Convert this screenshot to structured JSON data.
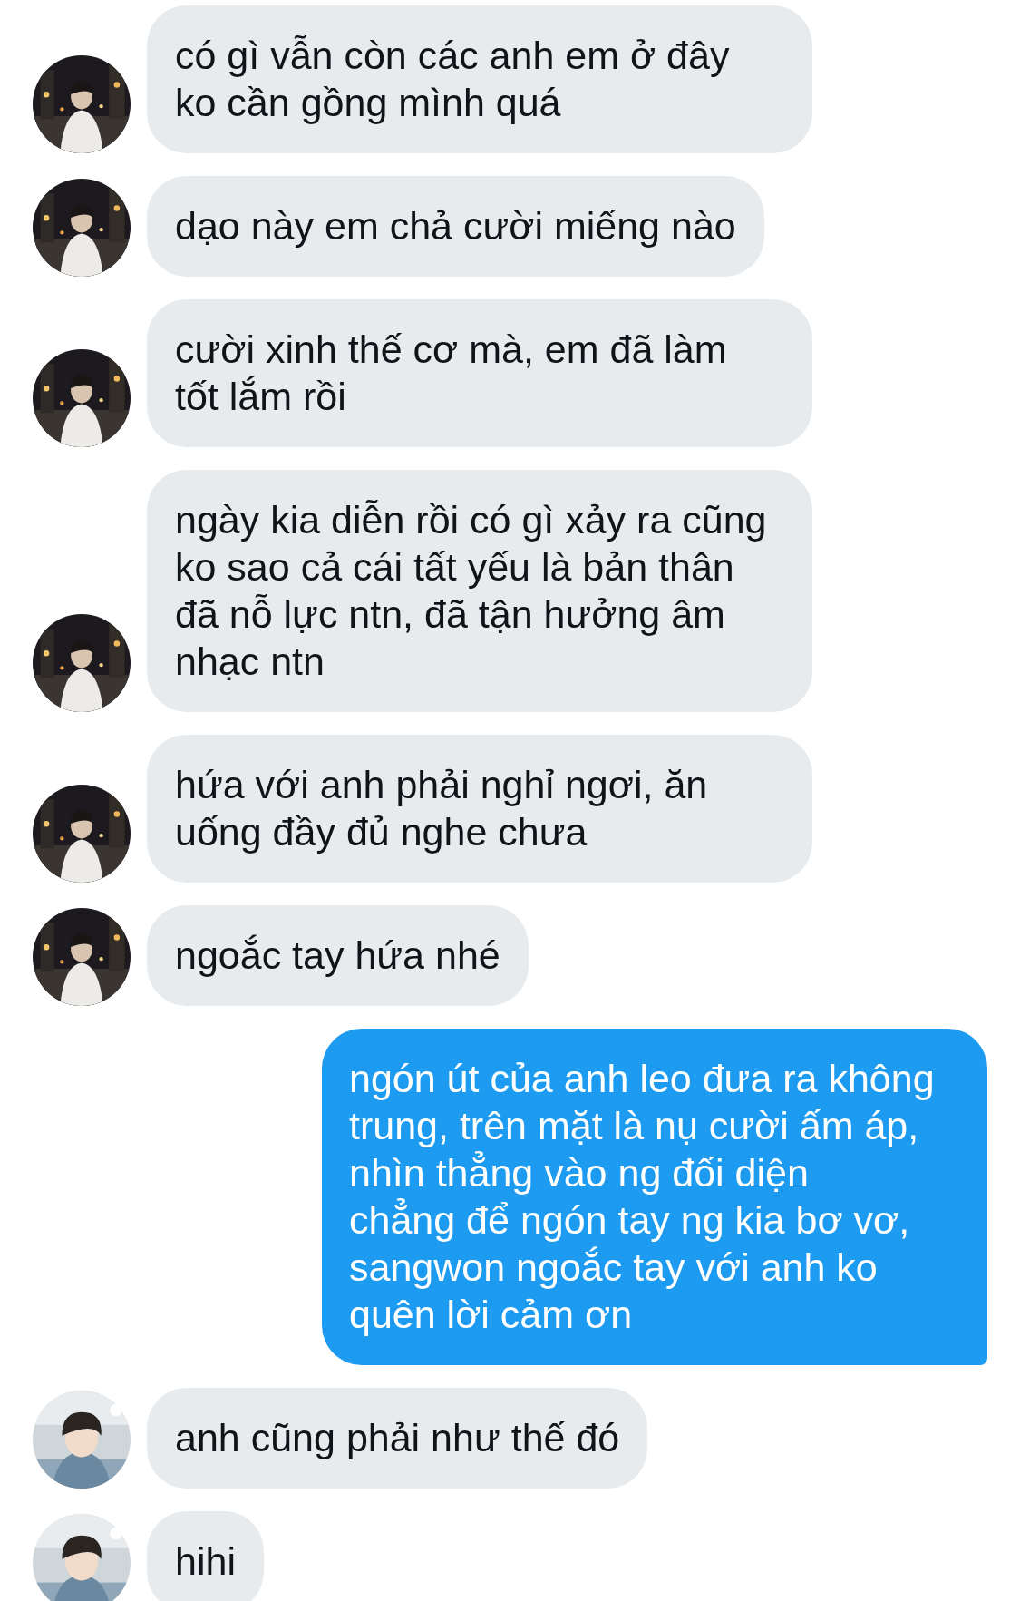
{
  "messages": [
    {
      "kind": "received",
      "text": "có gì vẫn còn các anh em ở đây\nko cần gồng mình quá"
    },
    {
      "kind": "received",
      "text": "dạo này em chả cười miếng nào"
    },
    {
      "kind": "received",
      "text": "cười xinh thế cơ mà, em đã làm\ntốt lắm rồi"
    },
    {
      "kind": "received",
      "text": "ngày kia diễn rồi có gì xảy ra cũng\nko sao cả cái tất yếu là bản thân\nđã nỗ lực ntn, đã tận hưởng âm\nnhạc ntn"
    },
    {
      "kind": "received",
      "text": "hứa với anh phải nghỉ ngơi, ăn\nuống đầy đủ nghe chưa"
    },
    {
      "kind": "received",
      "text": "ngoắc tay hứa nhé"
    },
    {
      "kind": "sent",
      "text": "ngón út của anh leo đưa ra không\ntrung, trên mặt là nụ cười ấm áp,\nnhìn thẳng vào ng đối diện\nchẳng để ngón tay ng kia bơ vơ,\nsangwon ngoắc tay với anh ko\nquên lời cảm ơn"
    },
    {
      "kind": "received",
      "text": "anh cũng phải như thế đó"
    },
    {
      "kind": "received",
      "text": "hihi"
    }
  ]
}
